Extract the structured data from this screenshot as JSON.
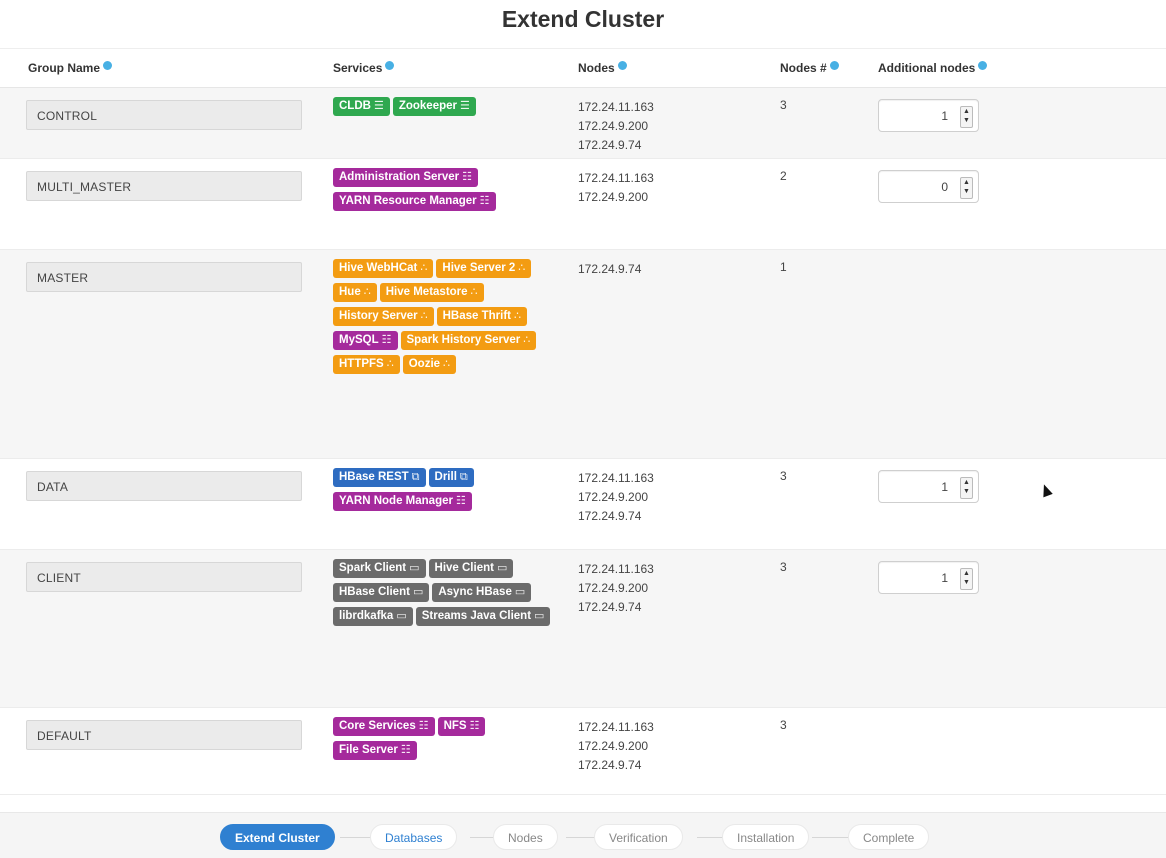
{
  "title": "Extend Cluster",
  "columns": {
    "group_name": "Group Name",
    "services": "Services",
    "nodes": "Nodes",
    "nodes_count": "Nodes #",
    "additional_nodes": "Additional nodes"
  },
  "rows": [
    {
      "group": "CONTROL",
      "services": [
        {
          "label": "CLDB",
          "color": "green",
          "icon": "server-icon"
        },
        {
          "label": "Zookeeper",
          "color": "green",
          "icon": "server-icon"
        }
      ],
      "nodes": [
        "172.24.11.163",
        "172.24.9.200",
        "172.24.9.74"
      ],
      "count": "3",
      "additional": "1"
    },
    {
      "group": "MULTI_MASTER",
      "services": [
        {
          "label": "Administration Server",
          "color": "purple",
          "icon": "list-icon"
        },
        {
          "label": "YARN Resource Manager",
          "color": "purple",
          "icon": "list-icon"
        }
      ],
      "nodes": [
        "172.24.11.163",
        "172.24.9.200"
      ],
      "count": "2",
      "additional": "0"
    },
    {
      "group": "MASTER",
      "services": [
        {
          "label": "Hive WebHCat",
          "color": "orange",
          "icon": "sitemap-icon"
        },
        {
          "label": "Hive Server 2",
          "color": "orange",
          "icon": "sitemap-icon"
        },
        {
          "label": "Hue",
          "color": "orange",
          "icon": "sitemap-icon"
        },
        {
          "label": "Hive Metastore",
          "color": "orange",
          "icon": "sitemap-icon"
        },
        {
          "label": "History Server",
          "color": "orange",
          "icon": "sitemap-icon"
        },
        {
          "label": "HBase Thrift",
          "color": "orange",
          "icon": "sitemap-icon"
        },
        {
          "label": "MySQL",
          "color": "purple",
          "icon": "list-icon"
        },
        {
          "label": "Spark History Server",
          "color": "orange",
          "icon": "sitemap-icon"
        },
        {
          "label": "HTTPFS",
          "color": "orange",
          "icon": "sitemap-icon"
        },
        {
          "label": "Oozie",
          "color": "orange",
          "icon": "sitemap-icon"
        }
      ],
      "nodes": [
        "172.24.9.74"
      ],
      "count": "1",
      "additional": null
    },
    {
      "group": "DATA",
      "services": [
        {
          "label": "HBase REST",
          "color": "blue",
          "icon": "copy-icon"
        },
        {
          "label": "Drill",
          "color": "blue",
          "icon": "copy-icon"
        },
        {
          "label": "YARN Node Manager",
          "color": "purple",
          "icon": "list-icon"
        }
      ],
      "nodes": [
        "172.24.11.163",
        "172.24.9.200",
        "172.24.9.74"
      ],
      "count": "3",
      "additional": "1"
    },
    {
      "group": "CLIENT",
      "services": [
        {
          "label": "Spark Client",
          "color": "gray",
          "icon": "monitor-icon"
        },
        {
          "label": "Hive Client",
          "color": "gray",
          "icon": "monitor-icon"
        },
        {
          "label": "HBase Client",
          "color": "gray",
          "icon": "monitor-icon"
        },
        {
          "label": "Async HBase",
          "color": "gray",
          "icon": "monitor-icon"
        },
        {
          "label": "librdkafka",
          "color": "gray",
          "icon": "monitor-icon"
        },
        {
          "label": "Streams Java Client",
          "color": "gray",
          "icon": "monitor-icon"
        }
      ],
      "nodes": [
        "172.24.11.163",
        "172.24.9.200",
        "172.24.9.74"
      ],
      "count": "3",
      "additional": "1"
    },
    {
      "group": "DEFAULT",
      "services": [
        {
          "label": "Core Services",
          "color": "purple",
          "icon": "list-icon"
        },
        {
          "label": "NFS",
          "color": "purple",
          "icon": "list-icon"
        },
        {
          "label": "File Server",
          "color": "purple",
          "icon": "list-icon"
        }
      ],
      "nodes": [
        "172.24.11.163",
        "172.24.9.200",
        "172.24.9.74"
      ],
      "count": "3",
      "additional": null
    }
  ],
  "steps": [
    "Extend Cluster",
    "Databases",
    "Nodes",
    "Verification",
    "Installation",
    "Complete"
  ],
  "active_step": "Extend Cluster",
  "colors": {
    "green": "#2fa84f",
    "purple": "#a52a9c",
    "orange": "#f39c12",
    "blue": "#2e6cc1",
    "gray": "#6b6b6b",
    "accent": "#2f80d1",
    "info": "#48b0e4"
  }
}
